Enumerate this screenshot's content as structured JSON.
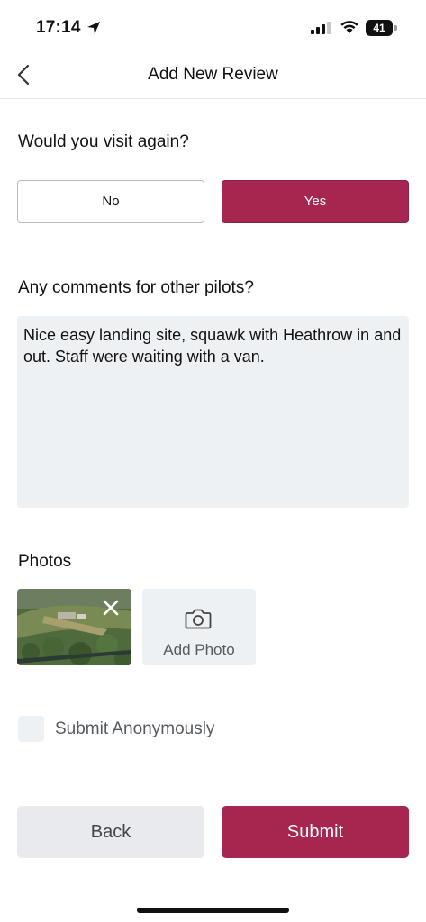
{
  "status_bar": {
    "time": "17:14",
    "battery": "41"
  },
  "nav": {
    "title": "Add New Review"
  },
  "visit_again": {
    "question": "Would you visit again?",
    "no_label": "No",
    "yes_label": "Yes",
    "selected": "Yes"
  },
  "comments": {
    "question": "Any comments for other pilots?",
    "value": "Nice easy landing site, squawk with Heathrow in and out. Staff were waiting with a van."
  },
  "photos": {
    "heading": "Photos",
    "add_label": "Add Photo"
  },
  "anonymous": {
    "label": "Submit Anonymously",
    "checked": false
  },
  "actions": {
    "back_label": "Back",
    "submit_label": "Submit"
  },
  "colors": {
    "accent": "#a6264f",
    "field_bg": "#eef1f4",
    "secondary_button": "#e8eaed"
  },
  "icons": [
    "location-arrow-icon",
    "signal-icon",
    "wifi-icon",
    "battery-icon",
    "chevron-left-icon",
    "close-icon",
    "camera-icon"
  ]
}
